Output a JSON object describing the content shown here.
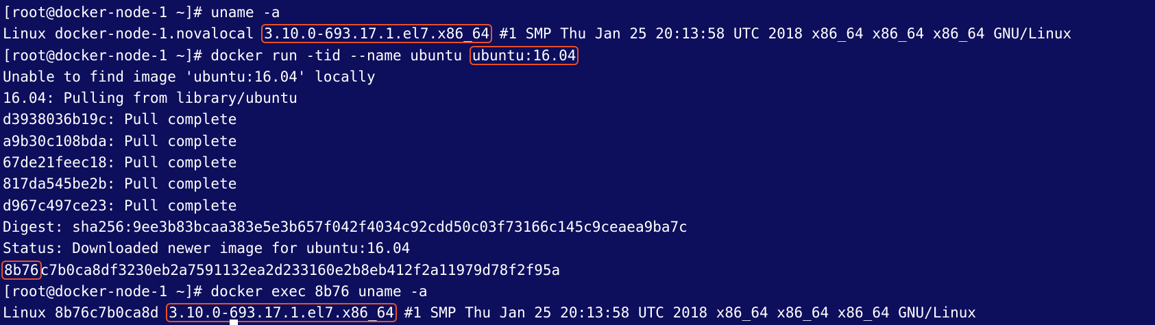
{
  "terminal": {
    "lines": [
      {
        "pre": "[root@docker-node-1 ~]# uname -a",
        "hl": "",
        "post": ""
      },
      {
        "pre": "Linux docker-node-1.novalocal ",
        "hl": "3.10.0-693.17.1.el7.x86_64",
        "post": " #1 SMP Thu Jan 25 20:13:58 UTC 2018 x86_64 x86_64 x86_64 GNU/Linux"
      },
      {
        "pre": "[root@docker-node-1 ~]# docker run -tid --name ubuntu ",
        "hl": "ubuntu:16.04",
        "post": ""
      },
      {
        "pre": "Unable to find image 'ubuntu:16.04' locally",
        "hl": "",
        "post": ""
      },
      {
        "pre": "16.04: Pulling from library/ubuntu",
        "hl": "",
        "post": ""
      },
      {
        "pre": "d3938036b19c: Pull complete",
        "hl": "",
        "post": ""
      },
      {
        "pre": "a9b30c108bda: Pull complete",
        "hl": "",
        "post": ""
      },
      {
        "pre": "67de21feec18: Pull complete",
        "hl": "",
        "post": ""
      },
      {
        "pre": "817da545be2b: Pull complete",
        "hl": "",
        "post": ""
      },
      {
        "pre": "d967c497ce23: Pull complete",
        "hl": "",
        "post": ""
      },
      {
        "pre": "Digest: sha256:9ee3b83bcaa383e5e3b657f042f4034c92cdd50c03f73166c145c9ceaea9ba7c",
        "hl": "",
        "post": ""
      },
      {
        "pre": "Status: Downloaded newer image for ubuntu:16.04",
        "hl": "",
        "post": ""
      },
      {
        "pre": "",
        "hl": "8b76",
        "post": "c7b0ca8df3230eb2a7591132ea2d233160e2b8eb412f2a11979d78f2f95a"
      },
      {
        "pre": "[root@docker-node-1 ~]# docker exec 8b76 uname -a",
        "hl": "",
        "post": ""
      },
      {
        "pre": "Linux 8b76c7b0ca8d ",
        "hl": "3.10.0-693.17.1.el7.x86_64",
        "post": " #1 SMP Thu Jan 25 20:13:58 UTC 2018 x86_64 x86_64 x86_64 GNU/Linux"
      }
    ]
  },
  "colors": {
    "background": "#0d0e5c",
    "text": "#ffffff",
    "highlight_border": "#e8512a"
  }
}
